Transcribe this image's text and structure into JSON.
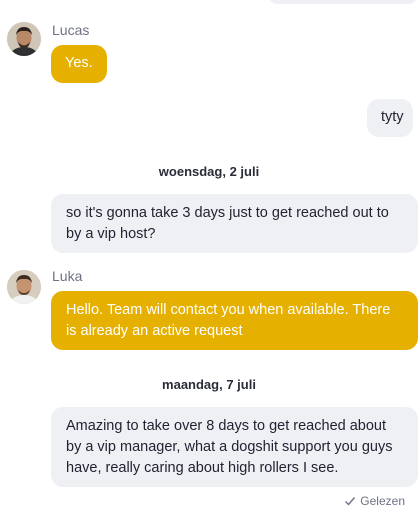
{
  "messages": [
    {
      "sender": "Lucas",
      "text": "Yes."
    },
    {
      "text": "tyty"
    },
    {
      "date": "woensdag, 2 juli"
    },
    {
      "text": "so it's gonna take 3 days just to get reached out to by a vip host?"
    },
    {
      "sender": "Luka",
      "text": "Hello. Team will contact you when available. There is already an active request"
    },
    {
      "date": "maandag, 7 juli"
    },
    {
      "text": "Amazing to take over 8 days to get reached about by a vip manager, what a dogshit support you guys have, really caring about high rollers I see."
    }
  ],
  "read_status": "Gelezen",
  "colors": {
    "agent_bubble": "#e6b000",
    "user_bubble": "#eef0f4",
    "muted_text": "#6d7284"
  },
  "icons": {
    "avatar": "person-avatar",
    "read": "check-icon"
  }
}
